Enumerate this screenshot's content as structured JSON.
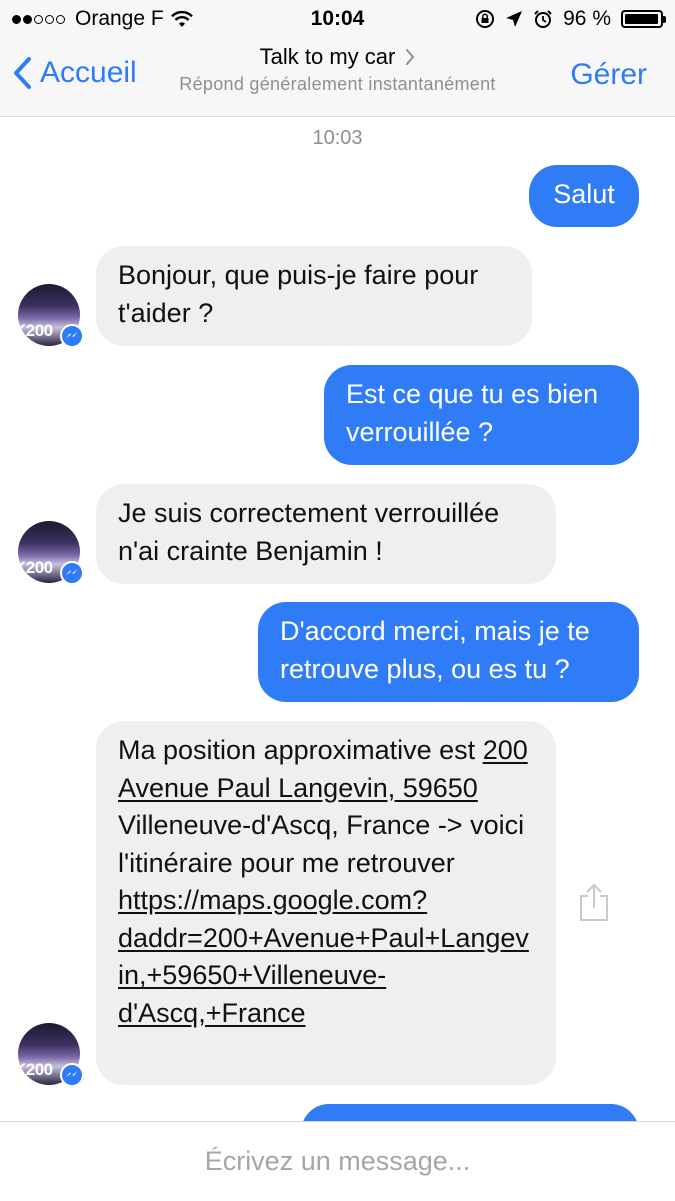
{
  "status": {
    "carrier": "Orange F",
    "time": "10:04",
    "battery": "96 %",
    "battery_level": 0.96
  },
  "nav": {
    "back_label": "Accueil",
    "title": "Talk to my car",
    "subtitle": "Répond généralement instantanément",
    "manage_label": "Gérer"
  },
  "conversation": {
    "timestamp": "10:03",
    "avatar_text": "K200",
    "messages": [
      {
        "from": "me",
        "text": "Salut"
      },
      {
        "from": "car",
        "text": "Bonjour, que puis-je faire pour t'aider ?"
      },
      {
        "from": "me",
        "text": "Est ce que tu es bien verrouillée ?"
      },
      {
        "from": "car",
        "text": "Je suis correctement verrouillée n'ai crainte Benjamin !"
      },
      {
        "from": "me",
        "text": "D'accord merci, mais je te retrouve plus, ou es tu ?"
      },
      {
        "from": "car",
        "parts": {
          "p1": "Ma position approximative est",
          "address_link": "200 Avenue Paul Langevin, 59650",
          "p2": "Villeneuve-d'Ascq, France -> voici l'itinéraire pour me retrouver",
          "map_link": "https://maps.google.com?daddr=200+Avenue+Paul+Langevin,+59650+Villeneuve-d'Ascq,+France"
        }
      }
    ]
  },
  "composer": {
    "placeholder": "Écrivez un message..."
  },
  "colors": {
    "accent": "#2f7cf6",
    "incoming_bubble": "#efeff1"
  }
}
